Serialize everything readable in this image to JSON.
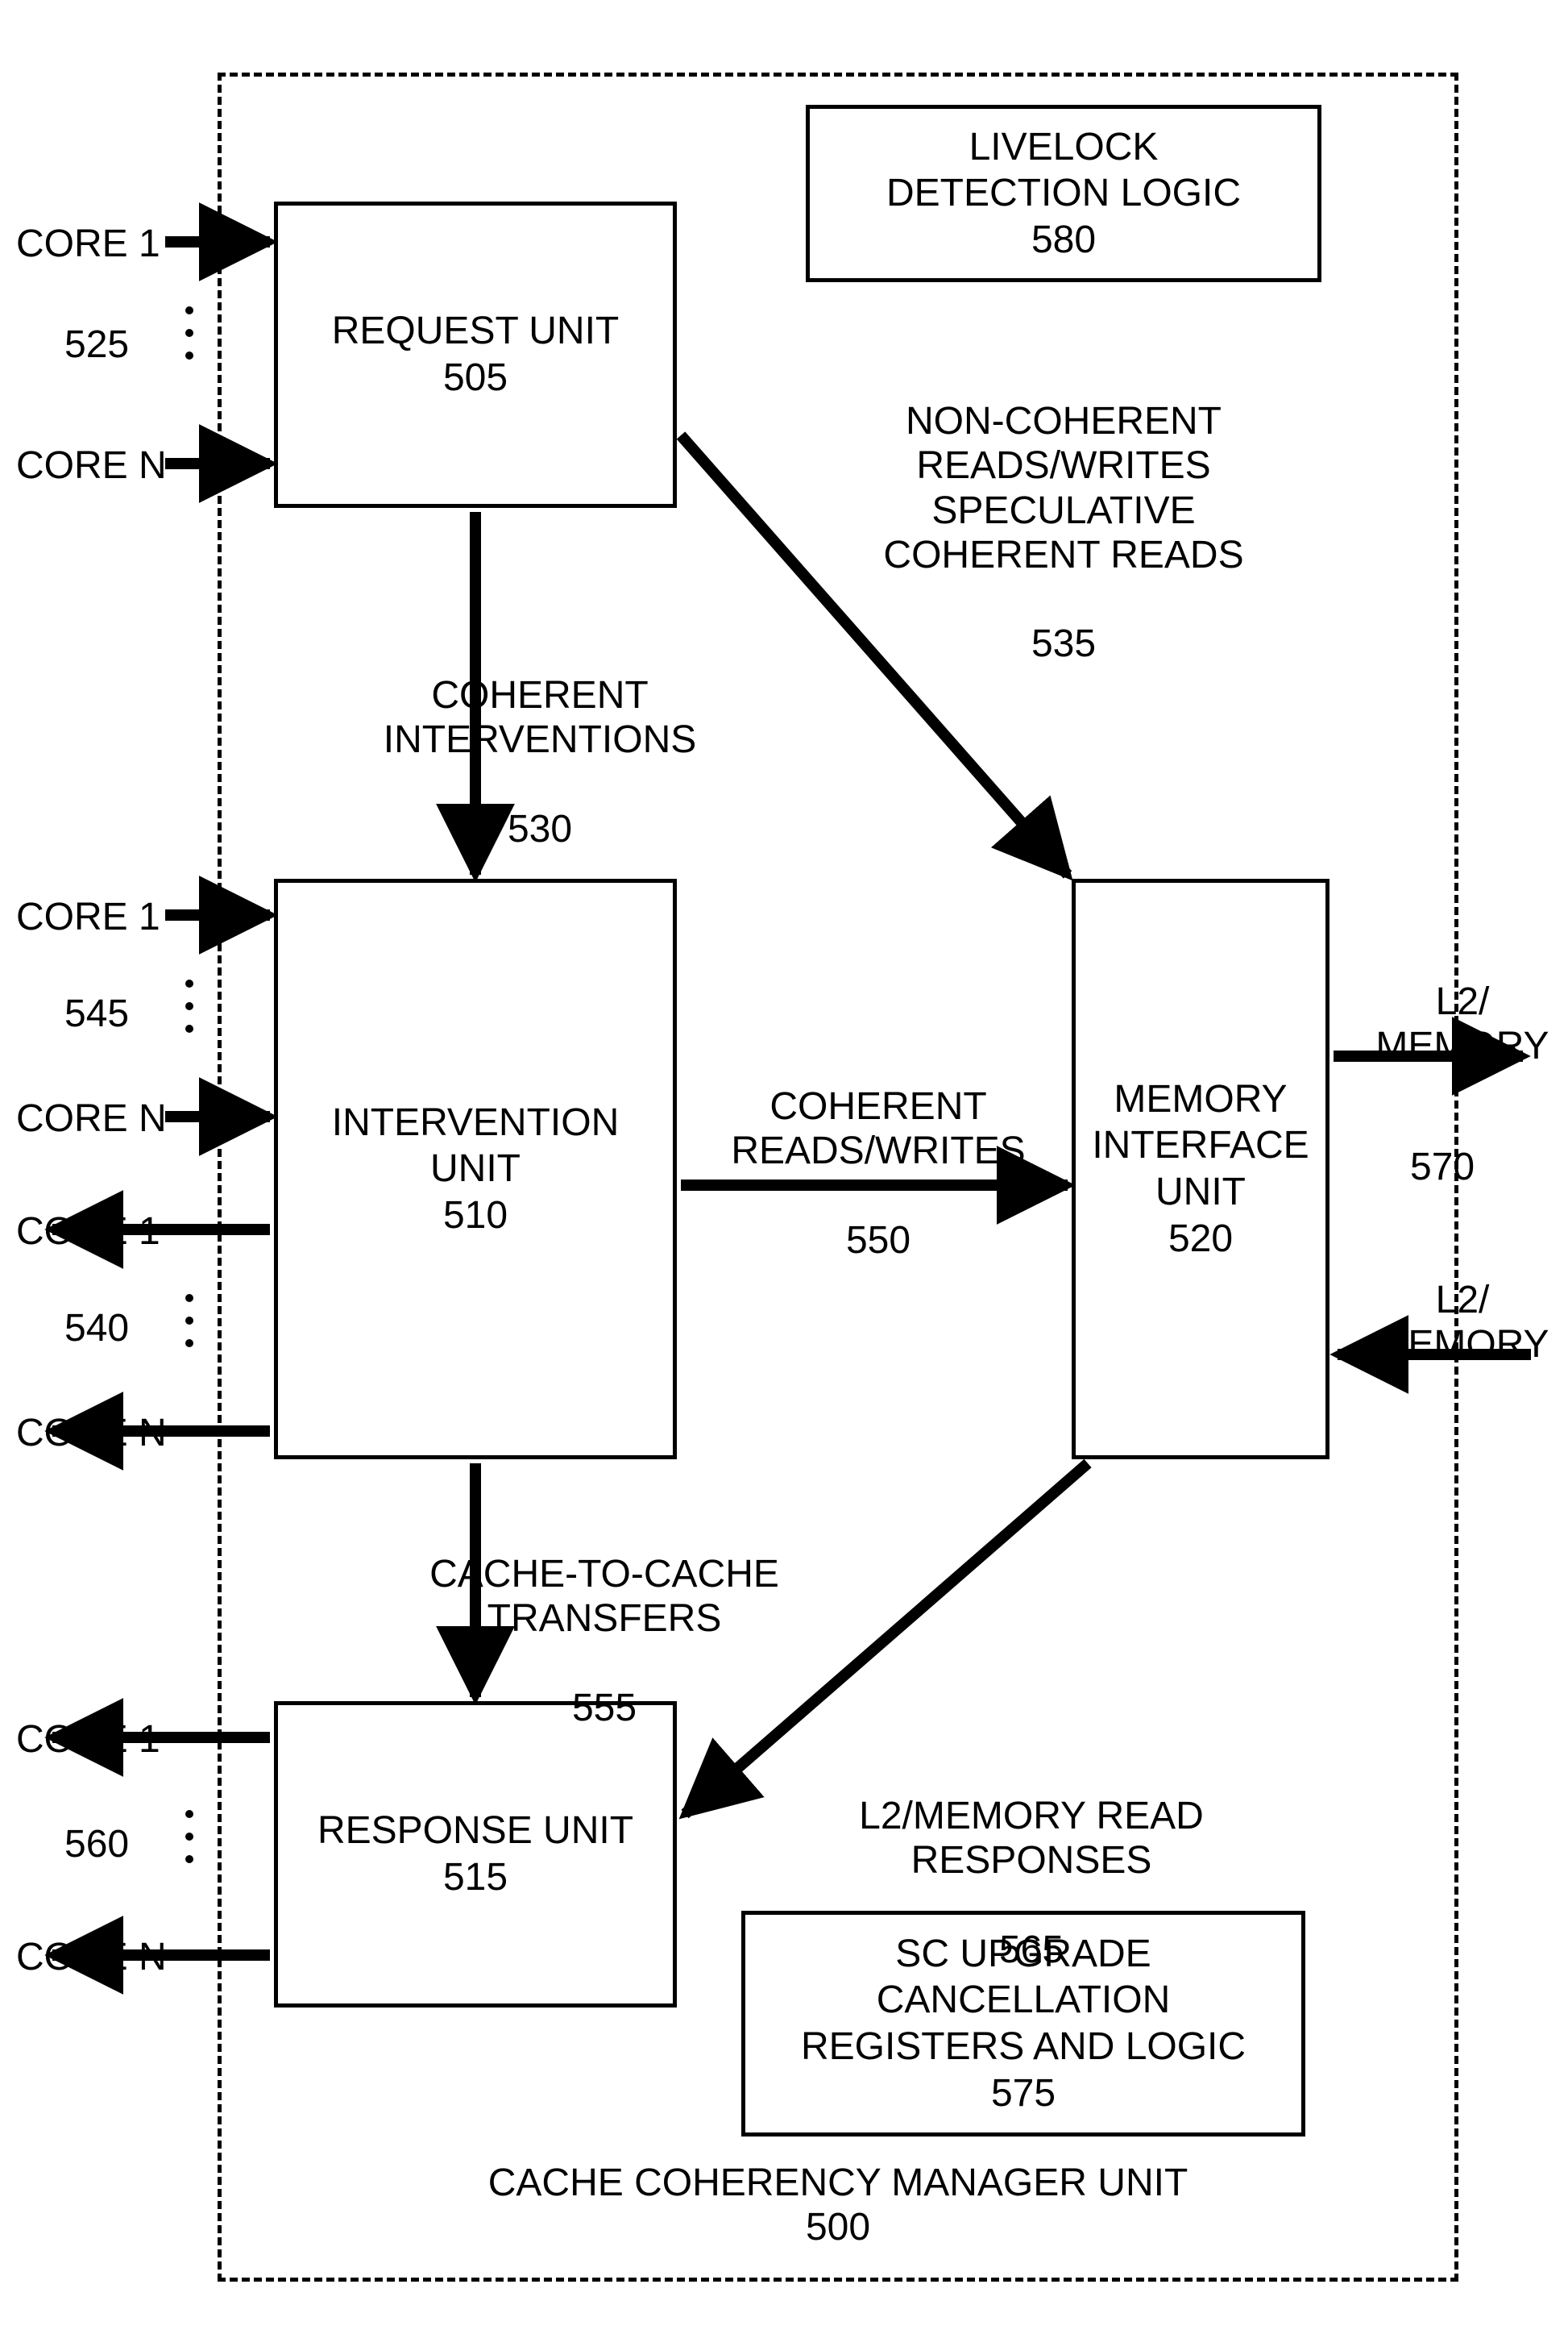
{
  "frame": {
    "title": "CACHE COHERENCY MANAGER UNIT",
    "id": "500"
  },
  "boxes": {
    "request": {
      "title": "REQUEST UNIT",
      "id": "505"
    },
    "intervention": {
      "title": "INTERVENTION\nUNIT",
      "id": "510"
    },
    "memory": {
      "title": "MEMORY\nINTERFACE\nUNIT",
      "id": "520"
    },
    "response": {
      "title": "RESPONSE UNIT",
      "id": "515"
    },
    "livelock": {
      "title": "LIVELOCK\nDETECTION LOGIC",
      "id": "580"
    },
    "scupgrade": {
      "title": "SC UPGRADE\nCANCELLATION\nREGISTERS AND LOGIC",
      "id": "575"
    }
  },
  "edges": {
    "coherent_interventions": {
      "title": "COHERENT\nINTERVENTIONS",
      "id": "530"
    },
    "noncoherent": {
      "title": "NON-COHERENT\nREADS/WRITES\nSPECULATIVE\nCOHERENT READS",
      "id": "535"
    },
    "coherent_rw": {
      "title": "COHERENT\nREADS/WRITES",
      "id": "550"
    },
    "cache_transfers": {
      "title": "CACHE-TO-CACHE\nTRANSFERS",
      "id": "555"
    },
    "l2_responses": {
      "title": "L2/MEMORY READ\nRESPONSES",
      "id": "565"
    }
  },
  "ports": {
    "left_1": {
      "core1": "CORE 1",
      "coreN": "CORE N",
      "id": "525"
    },
    "left_2": {
      "core1": "CORE 1",
      "coreN": "CORE N",
      "id": "545"
    },
    "left_3": {
      "core1": "CORE 1",
      "coreN": "CORE N",
      "id": "540"
    },
    "left_4": {
      "core1": "CORE 1",
      "coreN": "CORE N",
      "id": "560"
    },
    "right_out": {
      "text": "L2/\nMEMORY",
      "id": "570"
    },
    "right_in": {
      "text": "L2/\nMEMORY"
    }
  }
}
